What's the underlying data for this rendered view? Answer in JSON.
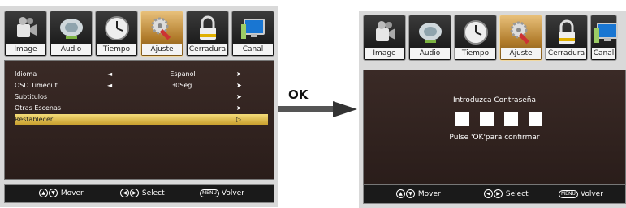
{
  "tabs": [
    {
      "label": "Image",
      "icon": "camcorder-icon"
    },
    {
      "label": "Audio",
      "icon": "speaker-icon"
    },
    {
      "label": "Tiempo",
      "icon": "clock-icon"
    },
    {
      "label": "Ajuste",
      "icon": "wrench-gear-icon"
    },
    {
      "label": "Cerradura",
      "icon": "lock-icon"
    },
    {
      "label": "Canal",
      "icon": "monitor-icon"
    }
  ],
  "left_menu": [
    {
      "label": "Idioma",
      "value": "Espanol",
      "left_arrow": "◄",
      "right_arrow": "➤"
    },
    {
      "label": "OSD Timeout",
      "value": "30Seg.",
      "left_arrow": "◄",
      "right_arrow": "➤"
    },
    {
      "label": "Subtitulos",
      "value": "",
      "left_arrow": "",
      "right_arrow": "➤"
    },
    {
      "label": "Otras Escenas",
      "value": "",
      "left_arrow": "",
      "right_arrow": "➤"
    },
    {
      "label": "Restablecer",
      "value": "",
      "left_arrow": "",
      "right_arrow": "▷",
      "selected": true
    }
  ],
  "footer": {
    "move_label": "Mover",
    "select_label": "Select",
    "back_label": "Volver",
    "menu_key": "MENU"
  },
  "transition_label": "OK",
  "password": {
    "title": "Introduzca Contraseña",
    "hint": "Pulse 'OK'para confirmar",
    "digits": 4
  },
  "colors": {
    "accent": "#d9b04a",
    "panel": "#2f221f"
  }
}
